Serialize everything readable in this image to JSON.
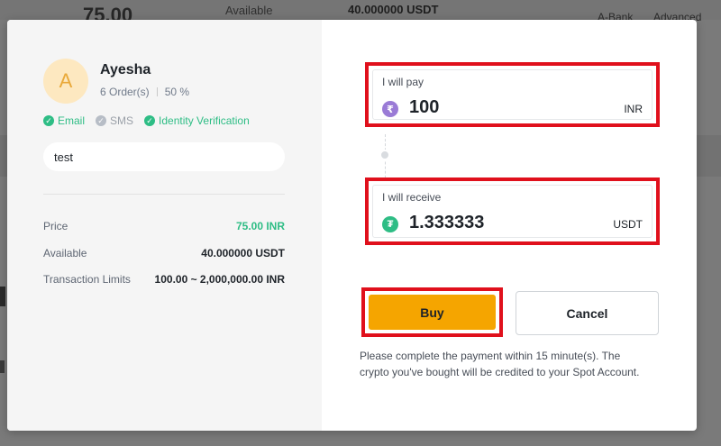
{
  "background": {
    "price": "75.00",
    "available_label": "Available",
    "available_value": "40.000000 USDT",
    "abank": "A-Bank",
    "advanced": "Advanced"
  },
  "seller": {
    "avatar_letter": "A",
    "name": "Ayesha",
    "orders": "6 Order(s)",
    "completion": "50 %"
  },
  "verifications": [
    {
      "label": "Email",
      "status": "verified"
    },
    {
      "label": "SMS",
      "status": "unverified"
    },
    {
      "label": "Identity Verification",
      "status": "verified"
    }
  ],
  "note": "test",
  "info": {
    "price_label": "Price",
    "price_value": "75.00 INR",
    "available_label": "Available",
    "available_value": "40.000000 USDT",
    "limits_label": "Transaction Limits",
    "limits_value": "100.00 ~ 2,000,000.00 INR"
  },
  "pay": {
    "label": "I will pay",
    "amount": "100",
    "currency": "INR",
    "icon": "rupee-coin-icon"
  },
  "receive": {
    "label": "I will receive",
    "amount": "1.333333",
    "currency": "USDT",
    "icon": "tether-coin-icon"
  },
  "buttons": {
    "buy": "Buy",
    "cancel": "Cancel"
  },
  "payment_note": "Please complete the payment within 15 minute(s). The crypto you've bought will be credited to your Spot Account.",
  "colors": {
    "accent": "#f5a500",
    "green": "#2ebd85",
    "highlight": "#e0101c"
  }
}
